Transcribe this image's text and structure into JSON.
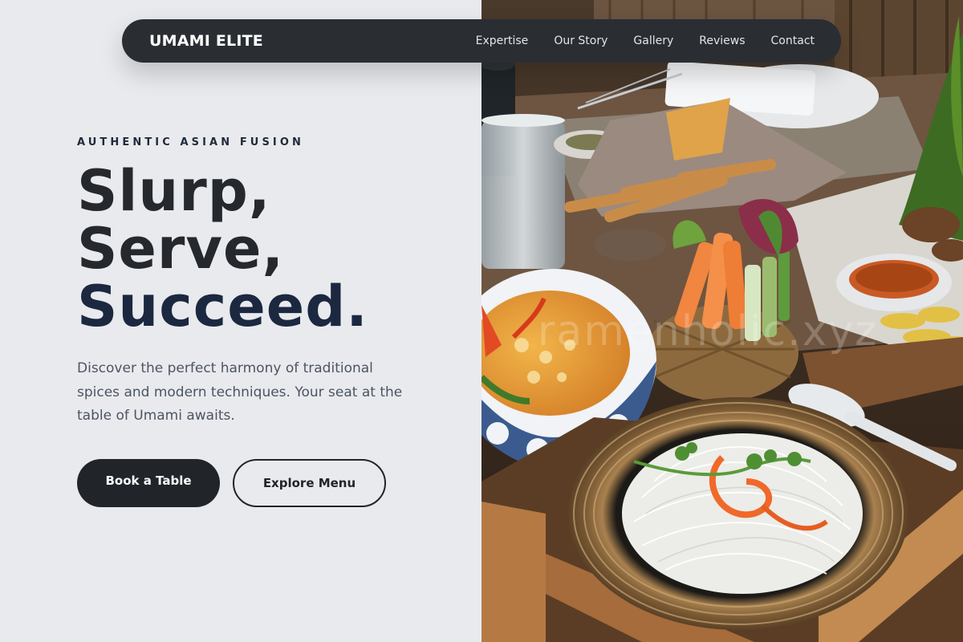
{
  "nav": {
    "brand": "UMAMI ELITE",
    "links": [
      "Expertise",
      "Our Story",
      "Gallery",
      "Reviews",
      "Contact"
    ]
  },
  "hero": {
    "eyebrow": "AUTHENTIC ASIAN FUSION",
    "headline": [
      "Slurp,",
      "Serve,",
      "Succeed."
    ],
    "description": "Discover the perfect harmony of traditional spices and modern techniques. Your seat at the table of Umami awaits.",
    "primary_cta": "Book a Table",
    "secondary_cta": "Explore Menu"
  },
  "image": {
    "watermark": "ramenholic.xyz"
  },
  "colors": {
    "background": "#e9eaee",
    "navbar": "#2a2e33",
    "primary_button": "#212529",
    "headline": "#25292e",
    "accent_headline": "#1b2840",
    "body_text": "#4c5562"
  }
}
